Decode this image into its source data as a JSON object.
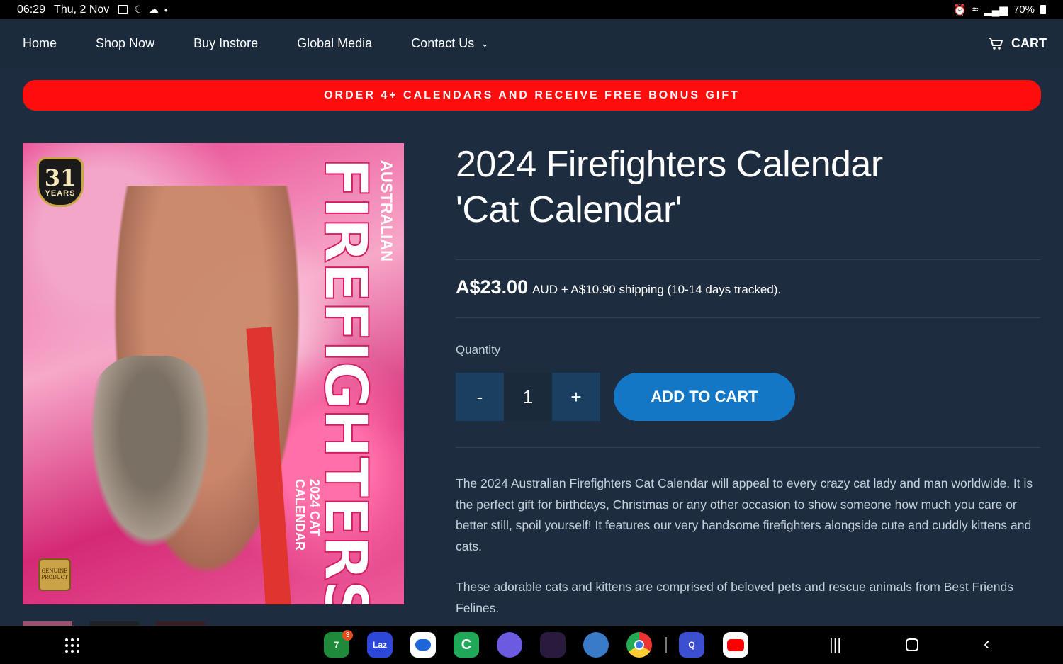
{
  "status": {
    "time": "06:29",
    "date": "Thu, 2 Nov",
    "battery": "70%"
  },
  "nav": {
    "items": [
      "Home",
      "Shop Now",
      "Buy Instore",
      "Global Media",
      "Contact Us"
    ],
    "cart": "CART"
  },
  "promo": "ORDER 4+ CALENDARS AND RECEIVE FREE BONUS GIFT",
  "image": {
    "badge_number": "31",
    "badge_word": "YEARS",
    "subtitle_top": "AUSTRALIAN",
    "title": "FIREFIGHTERS",
    "calendar_text": "2024 CAT CALENDAR",
    "seal_line1": "GENUINE",
    "seal_line2": "PRODUCT"
  },
  "product": {
    "title_line1": "2024 Firefighters Calendar",
    "title_line2": "'Cat Calendar'",
    "price": "A$23.00",
    "price_suffix": "AUD + A$10.90 shipping (10-14 days tracked).",
    "quantity_label": "Quantity",
    "quantity": "1",
    "minus": "-",
    "plus": "+",
    "add_to_cart": "ADD TO CART",
    "description_1": "The 2024 Australian Firefighters Cat Calendar will appeal to every crazy cat lady and man worldwide. It is the perfect gift for birthdays, Christmas or any other occasion to show someone how much you care or better still, spoil yourself! It features our very handsome firefighters alongside cute and cuddly kittens and cats.",
    "description_2": "These adorable cats and kittens are comprised of beloved pets and rescue animals from Best Friends Felines."
  },
  "dock": {
    "badge_count": "3",
    "apps": [
      {
        "name": "seven-eleven-icon",
        "color": "#1f8a3a",
        "label": "7"
      },
      {
        "name": "lazada-icon",
        "color": "#2d47d8",
        "label": "Laz"
      },
      {
        "name": "messages-icon",
        "color": "#ffffff",
        "label": ""
      },
      {
        "name": "phone-icon",
        "color": "#1fa858",
        "label": "C"
      },
      {
        "name": "browser-icon",
        "color": "#6a5be0",
        "label": ""
      },
      {
        "name": "streaming-icon",
        "color": "#2a1a3d",
        "label": ""
      },
      {
        "name": "game-app-icon",
        "color": "#3a7bc8",
        "label": ""
      },
      {
        "name": "chrome-icon",
        "color": "#ffffff",
        "label": ""
      },
      {
        "name": "search-app-icon",
        "color": "#3c4fd0",
        "label": "Q"
      },
      {
        "name": "youtube-icon",
        "color": "#ffffff",
        "label": ""
      }
    ]
  }
}
